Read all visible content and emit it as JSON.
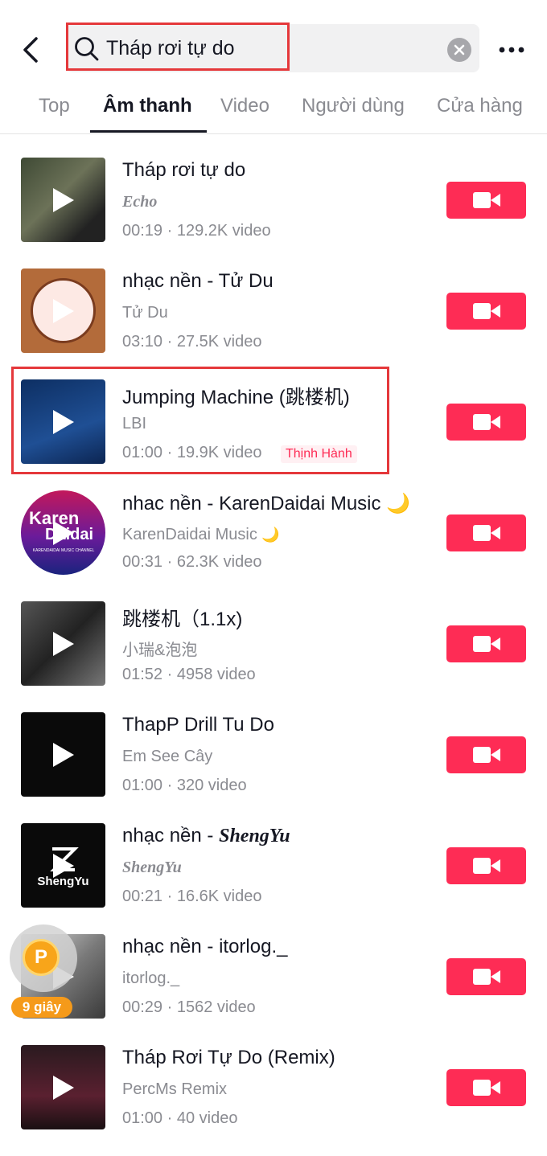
{
  "search": {
    "query": "Tháp rơi tự do"
  },
  "tabs": [
    {
      "label": "Top"
    },
    {
      "label": "Âm thanh"
    },
    {
      "label": "Video"
    },
    {
      "label": "Người dùng"
    },
    {
      "label": "Cửa hàng"
    }
  ],
  "active_tab": "Âm thanh",
  "sounds": [
    {
      "title": "Tháp rơi tự do",
      "author": "Echo",
      "meta": "00:19 · 129.2K video"
    },
    {
      "title": "nhạc nền - Tử Du",
      "author": "Tử Du",
      "meta": "03:10 · 27.5K video"
    },
    {
      "title": "Jumping Machine (跳楼机)",
      "author": "LBI",
      "meta": "01:00 · 19.9K video",
      "badge": "Thịnh Hành"
    },
    {
      "title": "nhac nền - KarenDaidai Music",
      "author": "KarenDaidai Music",
      "meta": "00:31 · 62.3K video"
    },
    {
      "title": "跳楼机（1.1x)",
      "author": "小瑞&泡泡",
      "meta": "01:52 · 4958 video"
    },
    {
      "title": "ThapP Drill Tu Do",
      "author": "Em See Cây",
      "meta": "01:00 · 320 video"
    },
    {
      "title": "nhạc nền - ",
      "title_styled": "ShengYu",
      "author": "ShengYu",
      "meta": "00:21 · 16.6K video"
    },
    {
      "title": "nhạc nền - itorlog._",
      "author": "itorlog._",
      "meta": "00:29 · 1562 video"
    },
    {
      "title": "Tháp Rơi Tự Do (Remix)",
      "author": "PercMs Remix",
      "meta": "01:00 · 40 video"
    }
  ],
  "thumb_texts": {
    "karen": "Karen",
    "daidai": "Daidai",
    "karen_channel": "KARENDAIDAI MUSIC CHANNEL",
    "shengyu": "ShengYu"
  },
  "reward": {
    "coin": "P",
    "timer": "9 giây"
  },
  "colors": {
    "accent": "#fe2c55",
    "highlight": "#e5383b",
    "coin": "#f8a51a"
  }
}
